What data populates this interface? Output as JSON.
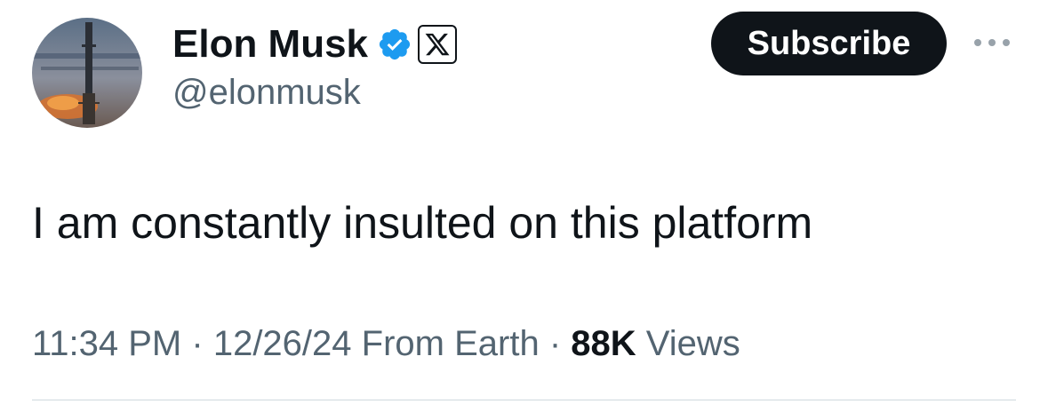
{
  "author": {
    "display_name": "Elon Musk",
    "handle": "@elonmusk",
    "verified_icon": "verified-badge-icon",
    "affiliation_icon": "x-logo-icon",
    "verified_color": "#1d9bf0"
  },
  "actions": {
    "subscribe_label": "Subscribe",
    "more_icon": "more-horizontal-icon"
  },
  "tweet": {
    "text": "I am constantly insulted on this platform",
    "time": "11:34 PM",
    "date": "12/26/24",
    "location": "From Earth",
    "separator": "·",
    "views_count": "88K",
    "views_label": "Views"
  },
  "colors": {
    "text_primary": "#0f1419",
    "text_secondary": "#536471",
    "button_bg": "#0f1419",
    "divider": "#cfd9de"
  }
}
